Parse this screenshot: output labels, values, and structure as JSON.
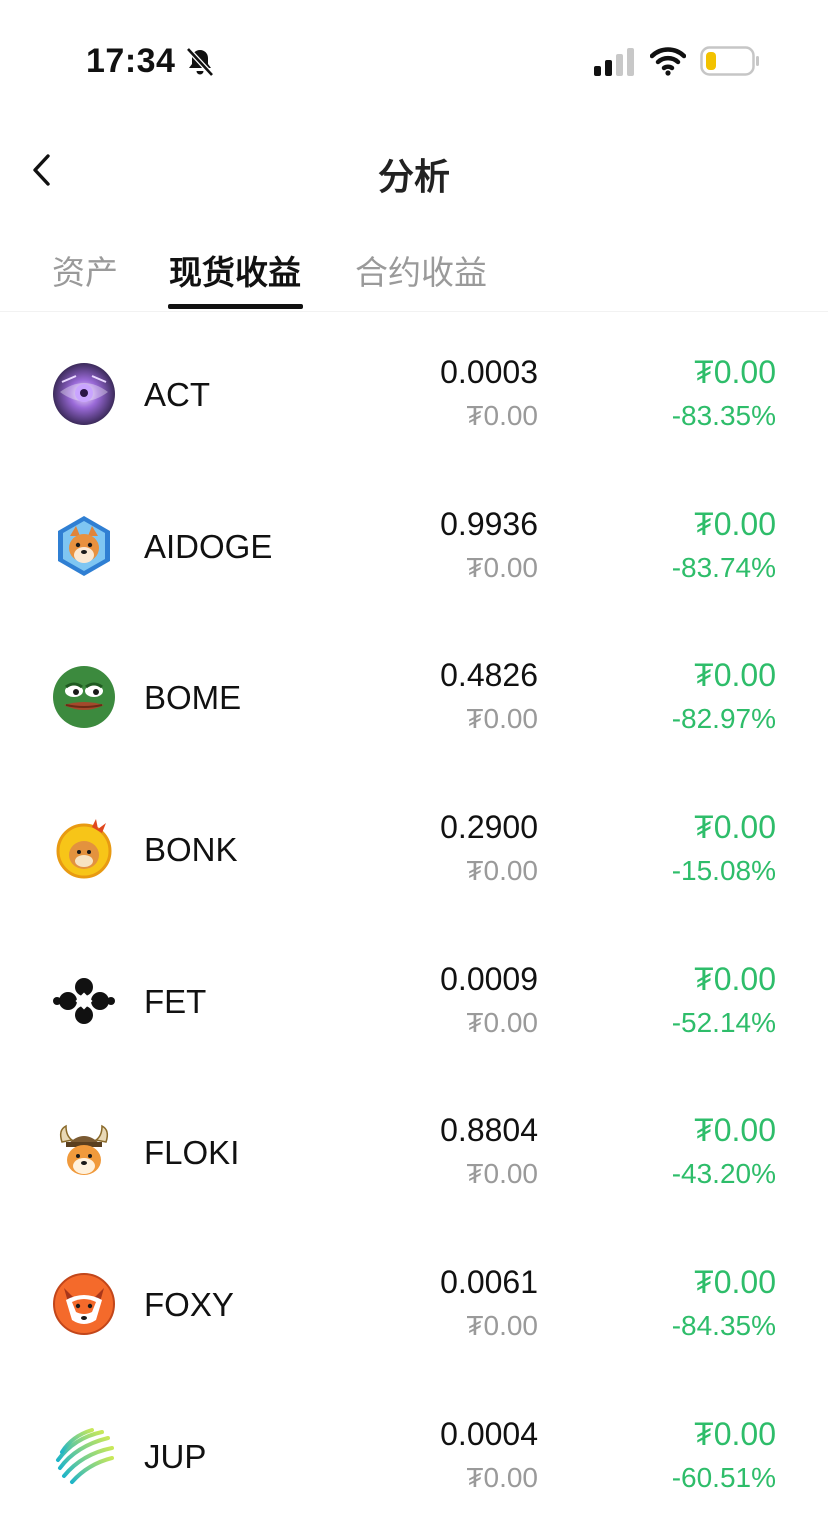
{
  "status_bar": {
    "time": "17:34"
  },
  "header": {
    "title": "分析"
  },
  "tabs": [
    {
      "label": "资产",
      "active": false
    },
    {
      "label": "现货收益",
      "active": true
    },
    {
      "label": "合约收益",
      "active": false
    }
  ],
  "colors": {
    "profit_green": "#2ebd6a",
    "muted_gray": "#9a9a9a",
    "text": "#111111"
  },
  "rows": [
    {
      "name": "ACT",
      "icon": "act-logo-icon",
      "amount": "0.0003",
      "value": "₮0.00",
      "pnl": "₮0.00",
      "pnl_pct": "-83.35%"
    },
    {
      "name": "AIDOGE",
      "icon": "aidoge-logo-icon",
      "amount": "0.9936",
      "value": "₮0.00",
      "pnl": "₮0.00",
      "pnl_pct": "-83.74%"
    },
    {
      "name": "BOME",
      "icon": "bome-logo-icon",
      "amount": "0.4826",
      "value": "₮0.00",
      "pnl": "₮0.00",
      "pnl_pct": "-82.97%"
    },
    {
      "name": "BONK",
      "icon": "bonk-logo-icon",
      "amount": "0.2900",
      "value": "₮0.00",
      "pnl": "₮0.00",
      "pnl_pct": "-15.08%"
    },
    {
      "name": "FET",
      "icon": "fet-logo-icon",
      "amount": "0.0009",
      "value": "₮0.00",
      "pnl": "₮0.00",
      "pnl_pct": "-52.14%"
    },
    {
      "name": "FLOKI",
      "icon": "floki-logo-icon",
      "amount": "0.8804",
      "value": "₮0.00",
      "pnl": "₮0.00",
      "pnl_pct": "-43.20%"
    },
    {
      "name": "FOXY",
      "icon": "foxy-logo-icon",
      "amount": "0.0061",
      "value": "₮0.00",
      "pnl": "₮0.00",
      "pnl_pct": "-84.35%"
    },
    {
      "name": "JUP",
      "icon": "jup-logo-icon",
      "amount": "0.0004",
      "value": "₮0.00",
      "pnl": "₮0.00",
      "pnl_pct": "-60.51%"
    }
  ]
}
